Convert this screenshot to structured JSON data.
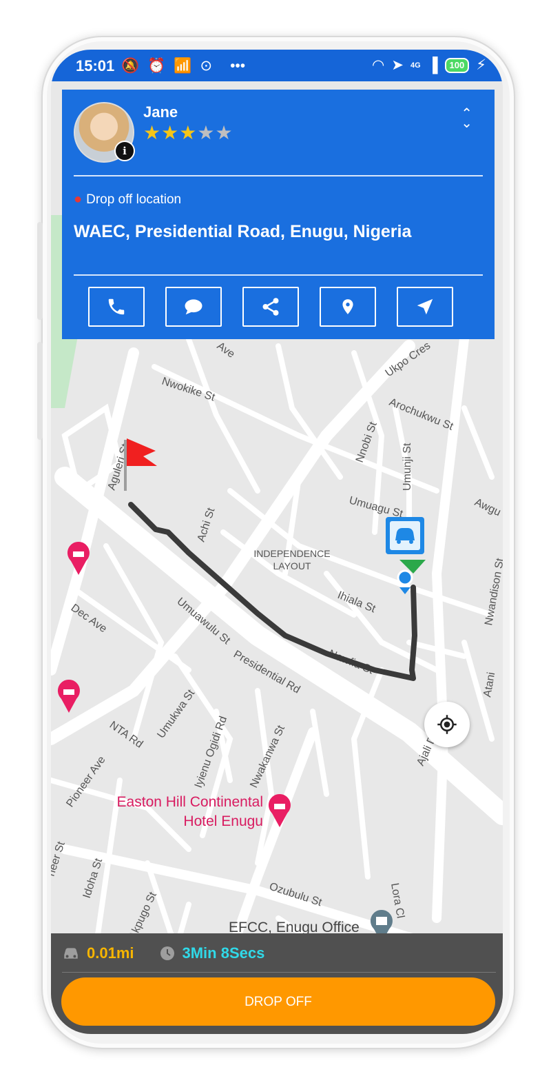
{
  "status_bar": {
    "time": "15:01",
    "battery": "100",
    "network": "4G"
  },
  "driver_card": {
    "name": "Jane",
    "rating": 3,
    "rating_max": 5,
    "drop_label": "Drop off location",
    "address": "WAEC, Presidential Road, Enugu, Nigeria",
    "actions": [
      "phone-icon",
      "chat-icon",
      "share-icon",
      "location-pin-icon",
      "navigate-icon"
    ]
  },
  "map": {
    "streets": [
      "Nwokike St",
      "Ave",
      "Ukpo Cres",
      "Arochukwu St",
      "Nnobi St",
      "Umunji St",
      "Umuagu St",
      "Awgu",
      "Aguleri St",
      "Achi St",
      "Ihiala St",
      "Nwandison St",
      "Nawfia St",
      "Dec Ave",
      "Umuawulu St",
      "Presidential Rd",
      "Atani",
      "Ajali D",
      "NTA Rd",
      "Umukwa St",
      "Iyienu Ogidi Rd",
      "Nwakanwa St",
      "Pioneer Ave",
      "Idoha St",
      "Akpugo St",
      "Ozubulu St",
      "Lora Cl",
      "neer St"
    ],
    "places": {
      "neighbourhood_line1": "INDEPENDENCE",
      "neighbourhood_line2": "LAYOUT",
      "hotel_line1": "Easton Hill Continental",
      "hotel_line2": "Hotel Enugu",
      "efcc": "EFCC, Enugu Office"
    },
    "route_color": "#3a3a3a"
  },
  "trip": {
    "distance": "0.01mi",
    "eta": "3Min 8Secs"
  },
  "drop_off_button": "DROP OFF",
  "colors": {
    "brand": "#1a6fdf",
    "accent": "#ff9800",
    "distance": "#f7b500",
    "eta": "#30d9e8"
  }
}
